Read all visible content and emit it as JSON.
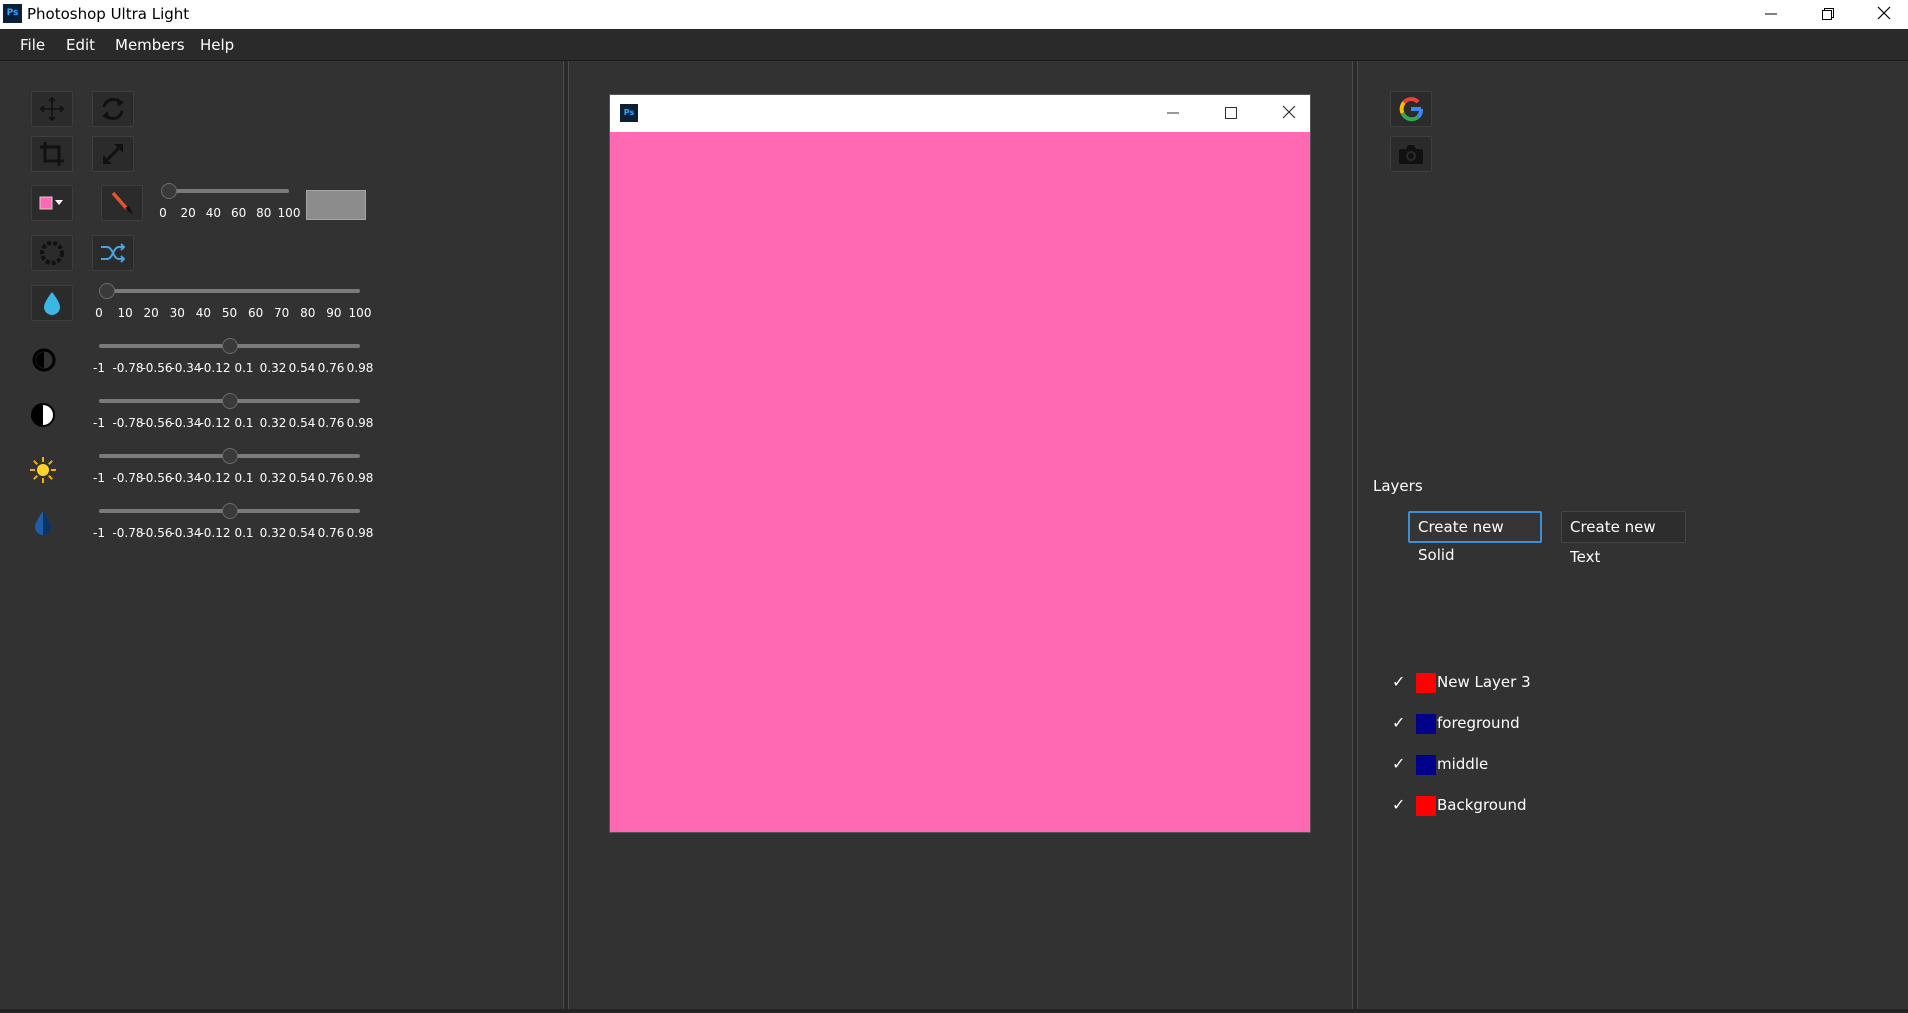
{
  "window": {
    "title": "Photoshop Ultra Light",
    "logo_text": "Ps",
    "minimize_icon": "minimize-icon",
    "maximize_icon": "restore-icon",
    "close_icon": "close-icon"
  },
  "menu": [
    {
      "label": "File"
    },
    {
      "label": "Edit"
    },
    {
      "label": "Members"
    },
    {
      "label": "Help"
    }
  ],
  "tools": {
    "move": "move-icon",
    "rotate": "rotate-icon",
    "crop": "crop-icon",
    "resize": "resize-icon",
    "color_picker": "color-dropdown-icon",
    "brush": "brush-icon",
    "filter": "filter-icon",
    "shuffle": "shuffle-icon",
    "drop": "water-drop-icon",
    "color_swatch": "#ff69b4",
    "preview_swatch": "#8c8c8c"
  },
  "brush_size_slider": {
    "value": 5,
    "min": 0,
    "max": 100,
    "ticks": [
      "0",
      "20",
      "40",
      "60",
      "80",
      "100"
    ]
  },
  "opacity_slider": {
    "value": 0,
    "min": 0,
    "max": 100,
    "ticks": [
      "0",
      "10",
      "20",
      "30",
      "40",
      "50",
      "60",
      "70",
      "80",
      "90",
      "100"
    ]
  },
  "adjustments": [
    {
      "name": "exposure",
      "icon": "half-circle-icon",
      "value": 0,
      "ticks": [
        "-1",
        "-0.78",
        "-0.56",
        "-0.34",
        "-0.12",
        "0.1",
        "0.32",
        "0.54",
        "0.76",
        "0.98"
      ]
    },
    {
      "name": "contrast",
      "icon": "contrast-icon",
      "value": 0,
      "ticks": [
        "-1",
        "-0.78",
        "-0.56",
        "-0.34",
        "-0.12",
        "0.1",
        "0.32",
        "0.54",
        "0.76",
        "0.98"
      ]
    },
    {
      "name": "brightness",
      "icon": "sun-icon",
      "value": 0,
      "ticks": [
        "-1",
        "-0.78",
        "-0.56",
        "-0.34",
        "-0.12",
        "0.1",
        "0.32",
        "0.54",
        "0.76",
        "0.98"
      ]
    },
    {
      "name": "saturation",
      "icon": "saturation-drop-icon",
      "value": 0,
      "ticks": [
        "-1",
        "-0.78",
        "-0.56",
        "-0.34",
        "-0.12",
        "0.1",
        "0.32",
        "0.54",
        "0.76",
        "0.98"
      ]
    }
  ],
  "canvas_window": {
    "logo_text": "Ps",
    "canvas_color": "#ff69b4"
  },
  "right_tools": {
    "google": "google-icon",
    "camera": "camera-icon"
  },
  "layers": {
    "label": "Layers",
    "create_solid": "Create new Solid",
    "create_text": "Create new Text",
    "items": [
      {
        "name": "New Layer 3",
        "visible": true,
        "color": "#ff0000"
      },
      {
        "name": "foreground",
        "visible": true,
        "color": "#00008b"
      },
      {
        "name": "middle",
        "visible": true,
        "color": "#00008b"
      },
      {
        "name": "Background",
        "visible": true,
        "color": "#ff0000"
      }
    ],
    "check_mark": "✓"
  }
}
